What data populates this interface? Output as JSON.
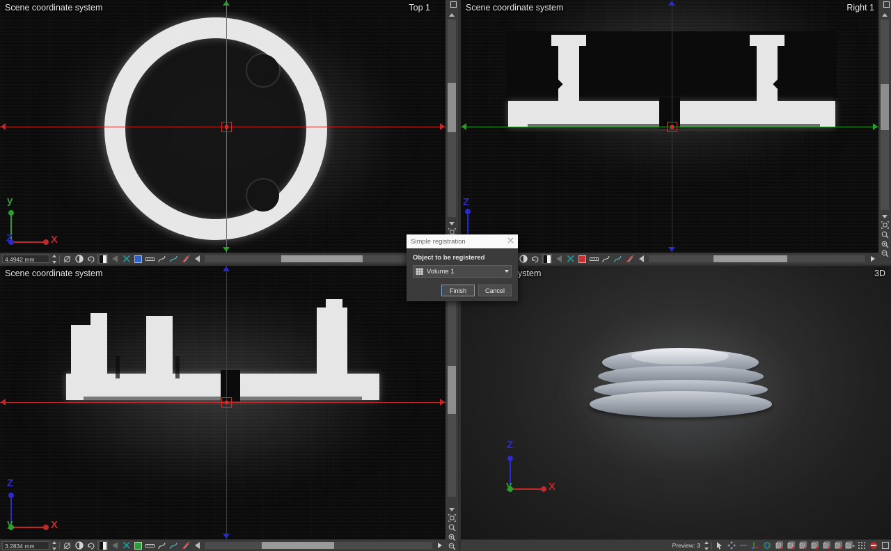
{
  "app": {
    "theme_bg": "#323232",
    "accent": "#d02c2c",
    "axis_x_color": "#c0282a",
    "axis_y_color": "#2aa02a",
    "axis_z_color": "#2a2ad0"
  },
  "panels": [
    {
      "id": "top-left",
      "title": "Scene coordinate system",
      "corner_label": "Top 1",
      "slice_value": "4.4942 mm",
      "gizmo": {
        "up_label": "y",
        "right_label": "X",
        "origin_label": "Z",
        "up_color": "#2aa02a",
        "right_color": "#c0282a",
        "origin_color": "#2a2ad0"
      }
    },
    {
      "id": "top-right",
      "title": "Scene coordinate system",
      "corner_label": "Right 1",
      "slice_value": "",
      "gizmo": null
    },
    {
      "id": "bottom-left",
      "title": "Scene coordinate system",
      "corner_label": "",
      "slice_value": "3.2834 mm",
      "gizmo": {
        "up_label": "Z",
        "right_label": "X",
        "origin_label": "y",
        "up_color": "#2a2ad0",
        "right_color": "#c0282a",
        "origin_color": "#2aa02a"
      }
    },
    {
      "id": "bottom-right",
      "title": "nate system",
      "corner_label": "3D",
      "slice_value": "",
      "gizmo": {
        "up_label": "Z",
        "right_label": "X",
        "origin_label": "y",
        "up_color": "#2a2ad0",
        "right_color": "#c0282a",
        "origin_color": "#2aa02a"
      }
    }
  ],
  "z_marker_label": "Z",
  "slice_toolbar": {
    "icons": [
      "spinner-icon",
      "measure-icon",
      "contrast-icon",
      "reset-icon",
      "grayscale-ramp-icon",
      "arrow-left-icon",
      "scissors-icon",
      "color-square-icon",
      "ruler-icon",
      "curve-icon",
      "spline-icon",
      "no-draw-icon",
      "play-left-icon"
    ],
    "square_colors": {
      "top-left": "#2f63c8",
      "top-right": "#c93232",
      "bottom-left": "#2f9c3a",
      "bottom-right": "#2f63c8"
    }
  },
  "rail": {
    "icons": [
      "collapse-down-icon",
      "fit-to-view-icon",
      "magnifier-icon",
      "zoom-in-icon",
      "zoom-out-icon",
      "expand-arrow-icon"
    ]
  },
  "viewport3d_toolbar": {
    "preview_label": "Preview:",
    "preview_value": "3",
    "icons": [
      "pointer-icon",
      "move-icon",
      "divider-icon",
      "axes-icon",
      "rotate-object-icon",
      "box-front-icon",
      "box-back-icon",
      "box-left-icon",
      "box-right-icon",
      "box-top-icon",
      "box-bottom-icon",
      "box-iso-icon",
      "grid-icon",
      "record-stop-icon",
      "square-icon"
    ]
  },
  "dialog": {
    "title": "Simple registration",
    "close_icon": "close-icon",
    "field_label": "Object to be registered",
    "object_icon": "volume-grid-icon",
    "object_value": "Volume 1",
    "dropdown_icon": "chevron-down-icon",
    "buttons": [
      {
        "label": "Finish",
        "primary": true
      },
      {
        "label": "Cancel",
        "primary": false
      }
    ]
  }
}
